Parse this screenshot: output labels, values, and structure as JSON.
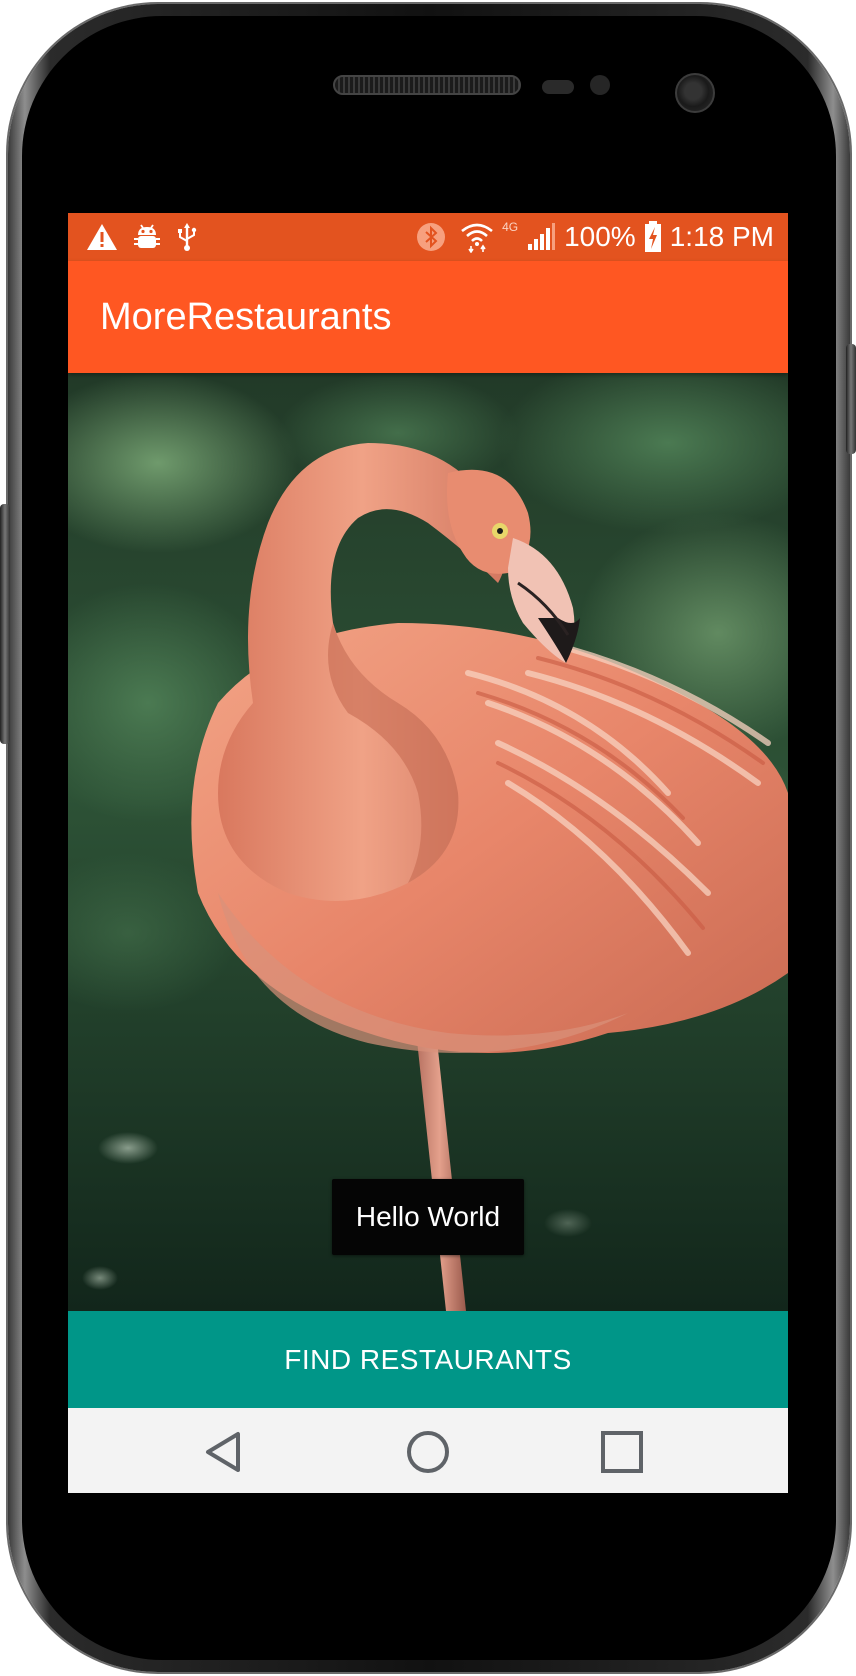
{
  "status_bar": {
    "left_icons": [
      "warning-icon",
      "android-debug-icon",
      "usb-icon"
    ],
    "right_icons": [
      "bluetooth-icon",
      "wifi-icon",
      "network-4g-icon",
      "signal-icon",
      "battery-charging-icon"
    ],
    "network_label": "4G",
    "battery": "100%",
    "time": "1:18 PM"
  },
  "app_bar": {
    "title": "MoreRestaurants"
  },
  "content": {
    "image": "flamingo-photo",
    "toast": "Hello World"
  },
  "action": {
    "find_label": "FIND RESTAURANTS"
  },
  "nav_bar": {
    "buttons": [
      "back-icon",
      "home-icon",
      "recents-icon"
    ]
  },
  "colors": {
    "status_bar": "#e3531f",
    "app_bar": "#ff5722",
    "button": "#009688",
    "nav_bar": "#f3f3f3"
  }
}
